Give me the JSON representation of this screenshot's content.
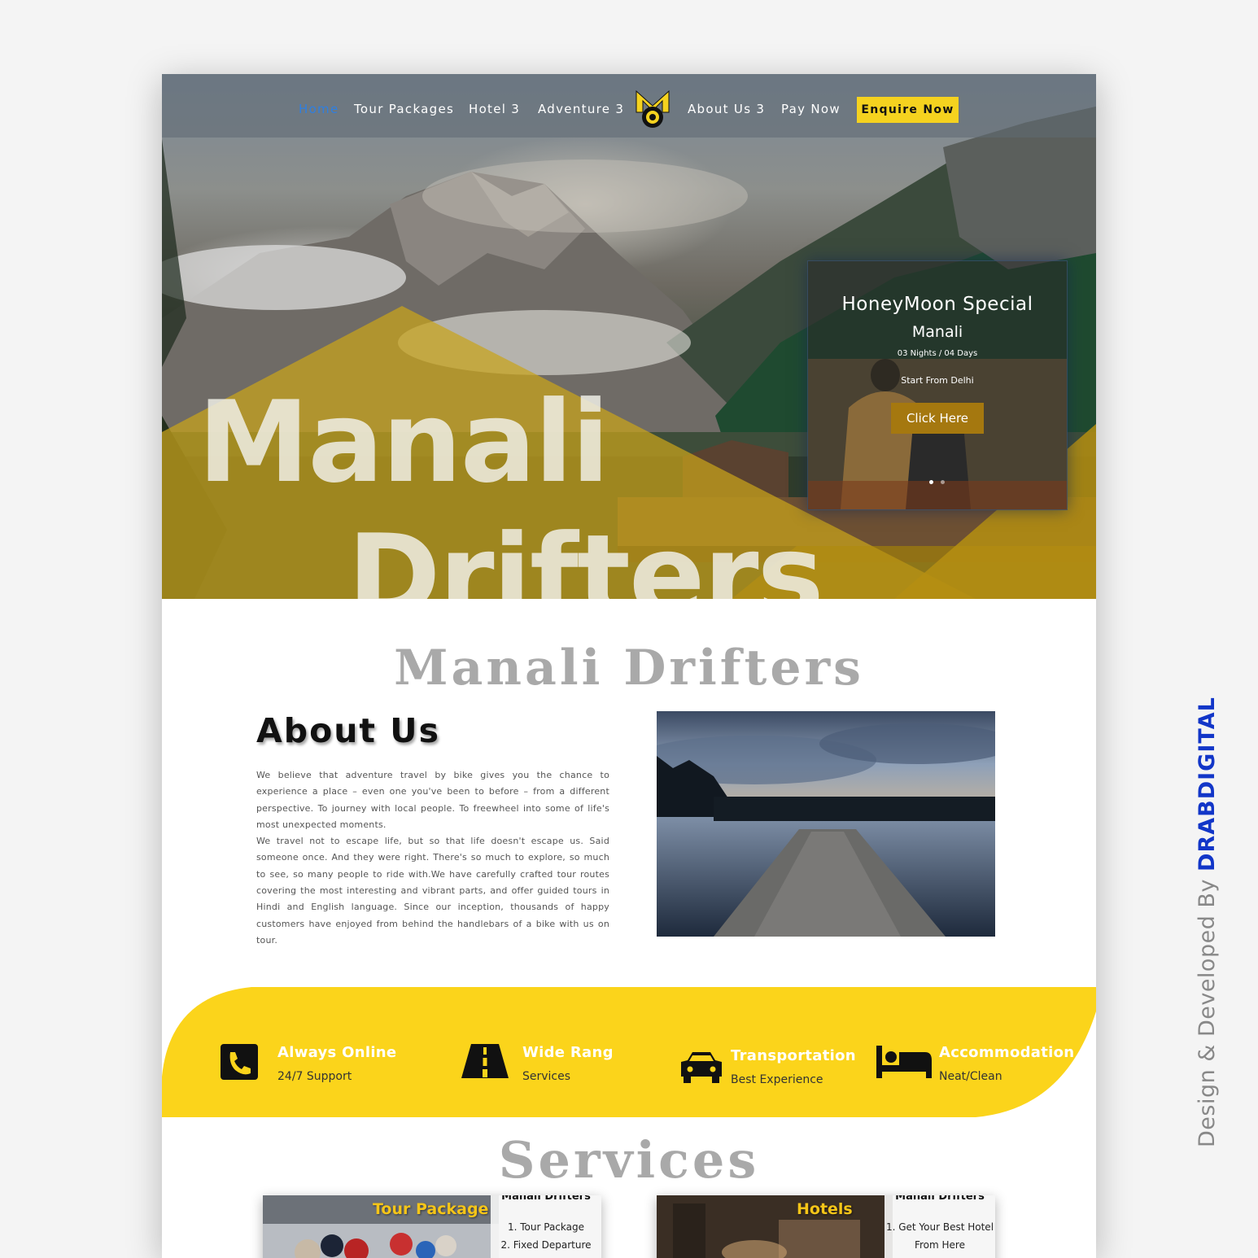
{
  "nav": {
    "items": [
      {
        "label": "Home"
      },
      {
        "label": "Tour Packages"
      },
      {
        "label": "Hotel 3"
      },
      {
        "label": "Adventure 3"
      },
      {
        "label": "About Us 3"
      },
      {
        "label": "Pay Now"
      }
    ],
    "enquire": "Enquire Now",
    "active_color": "#2f7fe0"
  },
  "hero": {
    "title_line1": "Manali",
    "title_line2": "Drifters",
    "accent": "#c9a41a"
  },
  "promo": {
    "title": "HoneyMoon Special",
    "place": "Manali",
    "duration": "03 Nights / 04 Days",
    "start": "Start From Delhi",
    "button": "Click Here",
    "slides": 2,
    "active_slide": 1
  },
  "about": {
    "brand": "Manali Drifters",
    "title": "About Us",
    "paragraph1": "We believe that adventure travel by bike gives you the chance to experience a place – even one you've been to before – from a different perspective. To journey with local people. To freewheel into some of life's most unexpected moments.",
    "paragraph2": "We travel not to escape life, but so that life doesn't escape us. Said someone once. And they were right. There's so much to explore, so much to see, so many people to ride with.We have carefully crafted tour routes covering the most interesting and vibrant parts, and offer guided tours in Hindi and English language. Since our inception, thousands of happy customers have enjoyed from behind the handlebars of a bike with us on tour."
  },
  "features": {
    "band_color": "#fbd41b",
    "items": [
      {
        "title": "Always Online",
        "sub": "24/7 Support",
        "icon": "phone-icon"
      },
      {
        "title": "Wide Rang",
        "sub": "Services",
        "icon": "road-icon"
      },
      {
        "title": "Transportation",
        "sub": "Best Experience",
        "icon": "car-icon"
      },
      {
        "title": "Accommodation",
        "sub": "Neat/Clean",
        "icon": "bed-icon"
      }
    ]
  },
  "services": {
    "heading": "Services",
    "cards": [
      {
        "title": "Tour Package",
        "brand": "Manali Drifters",
        "line1": "1. Tour Package",
        "line2": "2. Fixed Departure"
      },
      {
        "title": "Hotels",
        "brand": "Manali Drifters",
        "line1": "1. Get Your Best  Hotel",
        "line2": "From Here"
      }
    ]
  },
  "credit": {
    "prefix": "Design & Developed By",
    "brand": "DRABDIGITAL"
  }
}
